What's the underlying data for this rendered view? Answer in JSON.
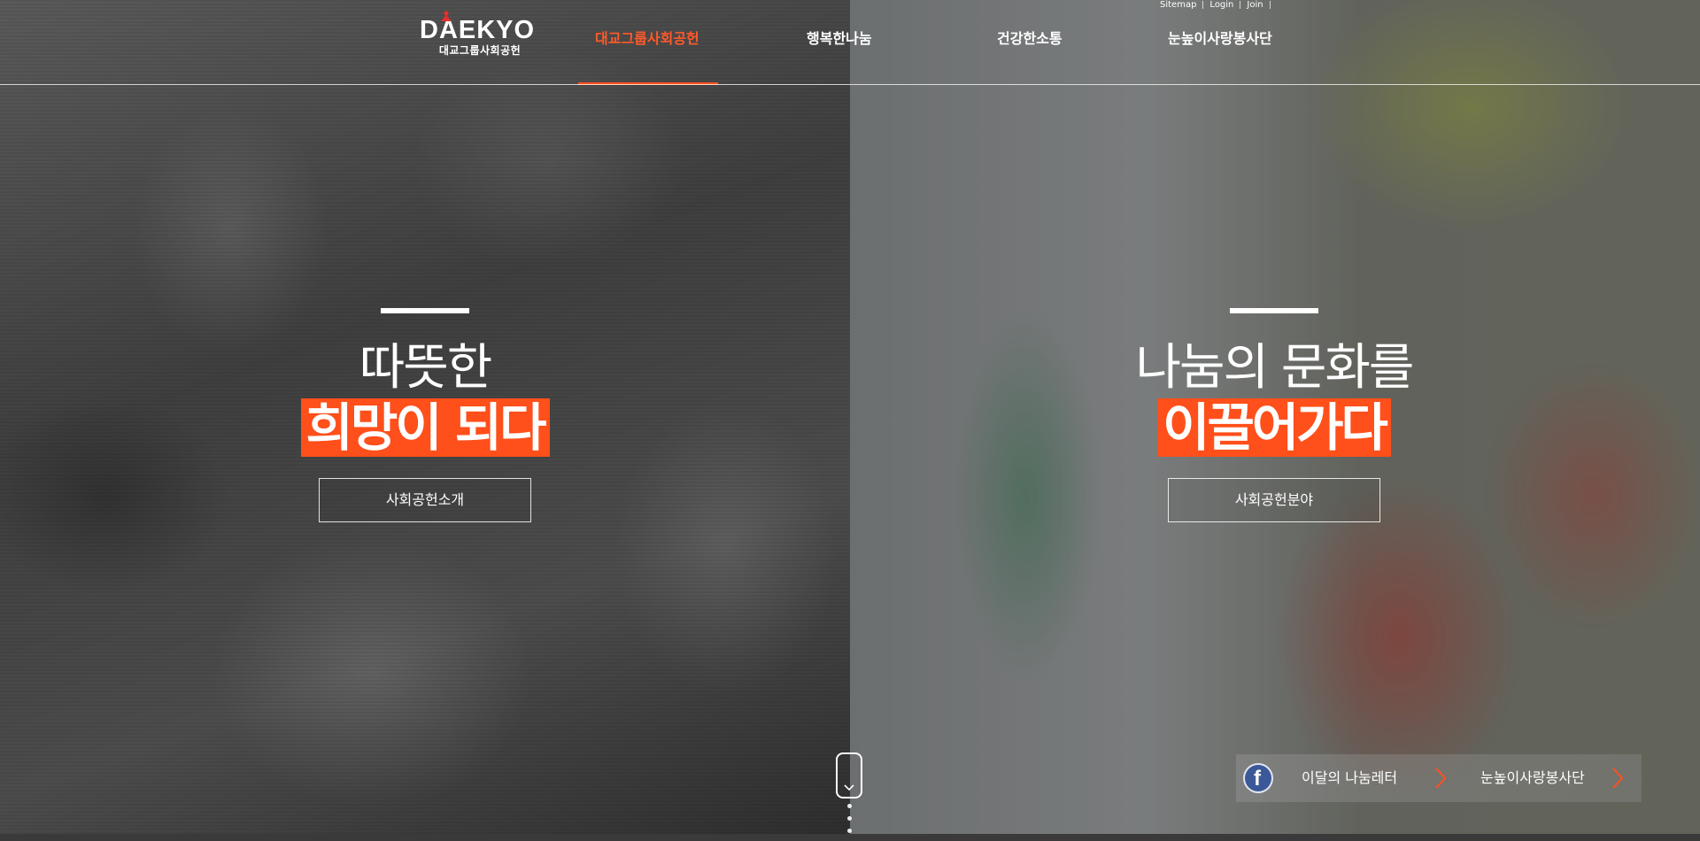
{
  "brand": {
    "logo_word": "DAEKYO",
    "logo_sub": "대교그룹사회공헌",
    "accent": "#ff5020"
  },
  "utility": {
    "sitemap": "Sitemap",
    "login": "Login",
    "join": "Join"
  },
  "nav": {
    "items": [
      {
        "label": "대교그룹사회공헌",
        "active": true
      },
      {
        "label": "행복한나눔",
        "active": false
      },
      {
        "label": "건강한소통",
        "active": false
      },
      {
        "label": "눈높이사랑봉사단",
        "active": false
      }
    ]
  },
  "hero_left": {
    "line1": "따뜻한",
    "line2": "희망이 되다",
    "button": "사회공헌소개"
  },
  "hero_right": {
    "line1": "나눔의 문화를",
    "line2": "이끌어가다",
    "button": "사회공헌분야"
  },
  "quick_links": {
    "facebook_icon": "facebook-icon",
    "newsletter": "이달의 나눔레터",
    "volunteer": "눈높이사랑봉사단"
  },
  "scroll": {
    "icon": "chevron-down-icon",
    "dots": 3
  }
}
